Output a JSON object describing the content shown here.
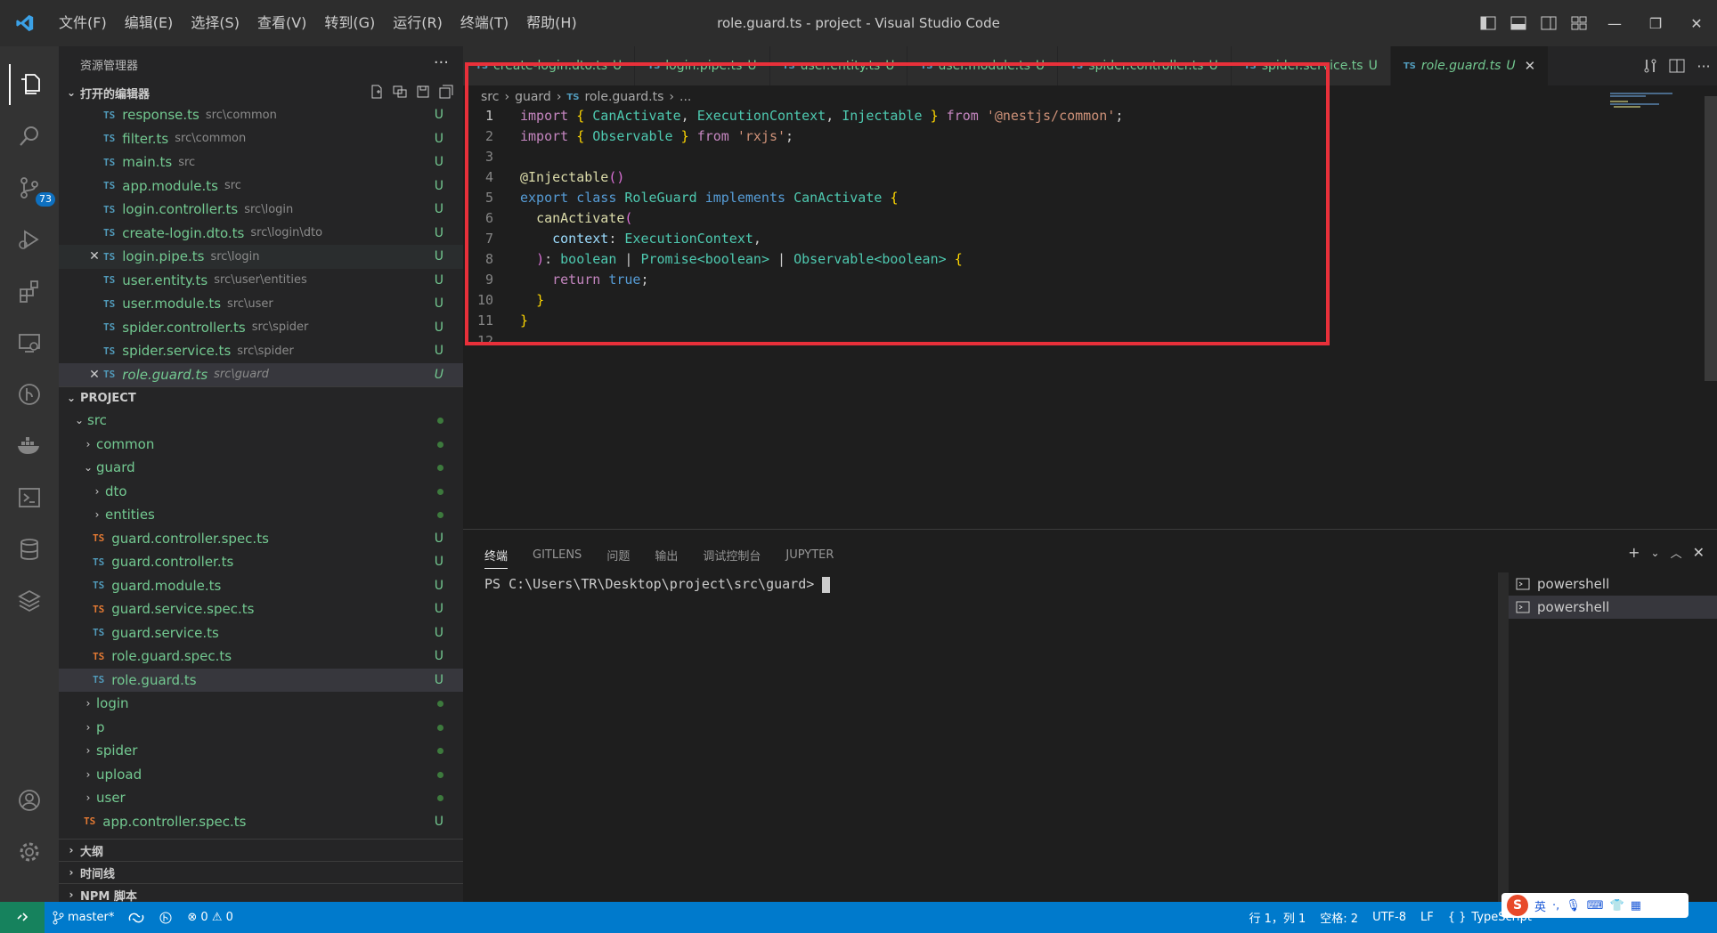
{
  "title_bar": {
    "menus": [
      "文件(F)",
      "编辑(E)",
      "选择(S)",
      "查看(V)",
      "转到(G)",
      "运行(R)",
      "终端(T)",
      "帮助(H)"
    ],
    "window_title": "role.guard.ts - project - Visual Studio Code"
  },
  "activity_bar": {
    "scm_badge": "73"
  },
  "sidebar": {
    "title": "资源管理器",
    "open_editors": {
      "label": "打开的编辑器",
      "items": [
        {
          "name": "response.ts",
          "path": "src\\common",
          "status": "U"
        },
        {
          "name": "filter.ts",
          "path": "src\\common",
          "status": "U"
        },
        {
          "name": "main.ts",
          "path": "src",
          "status": "U"
        },
        {
          "name": "app.module.ts",
          "path": "src",
          "status": "U"
        },
        {
          "name": "login.controller.ts",
          "path": "src\\login",
          "status": "U"
        },
        {
          "name": "create-login.dto.ts",
          "path": "src\\login\\dto",
          "status": "U"
        },
        {
          "name": "login.pipe.ts",
          "path": "src\\login",
          "status": "U"
        },
        {
          "name": "user.entity.ts",
          "path": "src\\user\\entities",
          "status": "U"
        },
        {
          "name": "user.module.ts",
          "path": "src\\user",
          "status": "U"
        },
        {
          "name": "spider.controller.ts",
          "path": "src\\spider",
          "status": "U"
        },
        {
          "name": "spider.service.ts",
          "path": "src\\spider",
          "status": "U"
        },
        {
          "name": "role.guard.ts",
          "path": "src\\guard",
          "status": "U"
        }
      ]
    },
    "project": {
      "label": "PROJECT",
      "src": "src",
      "items": [
        {
          "name": "common"
        },
        {
          "name": "guard"
        },
        {
          "name": "dto"
        },
        {
          "name": "entities"
        },
        {
          "name": "guard.controller.spec.ts",
          "status": "U"
        },
        {
          "name": "guard.controller.ts",
          "status": "U"
        },
        {
          "name": "guard.module.ts",
          "status": "U"
        },
        {
          "name": "guard.service.spec.ts",
          "status": "U"
        },
        {
          "name": "guard.service.ts",
          "status": "U"
        },
        {
          "name": "role.guard.spec.ts",
          "status": "U"
        },
        {
          "name": "role.guard.ts",
          "status": "U"
        },
        {
          "name": "login"
        },
        {
          "name": "p"
        },
        {
          "name": "spider"
        },
        {
          "name": "upload"
        },
        {
          "name": "user"
        },
        {
          "name": "app.controller.spec.ts",
          "status": "U"
        }
      ]
    },
    "outline": "大纲",
    "timeline": "时间线",
    "npm": "NPM 脚本"
  },
  "tabs": [
    {
      "label": "create-login.dto.ts",
      "status": "U"
    },
    {
      "label": "login.pipe.ts",
      "status": "U"
    },
    {
      "label": "user.entity.ts",
      "status": "U"
    },
    {
      "label": "user.module.ts",
      "status": "U"
    },
    {
      "label": "spider.controller.ts",
      "status": "U"
    },
    {
      "label": "spider.service.ts",
      "status": "U"
    },
    {
      "label": "role.guard.ts",
      "status": "U"
    }
  ],
  "breadcrumb": [
    "src",
    "guard",
    "role.guard.ts",
    "..."
  ],
  "code_lines": [
    "import { CanActivate, ExecutionContext, Injectable } from '@nestjs/common';",
    "import { Observable } from 'rxjs';",
    "",
    "@Injectable()",
    "export class RoleGuard implements CanActivate {",
    "  canActivate(",
    "    context: ExecutionContext,",
    "  ): boolean | Promise<boolean> | Observable<boolean> {",
    "    return true;",
    "  }",
    "}",
    ""
  ],
  "panel": {
    "tabs": [
      "终端",
      "GITLENS",
      "问题",
      "输出",
      "调试控制台",
      "JUPYTER"
    ],
    "prompt": "PS C:\\Users\\TR\\Desktop\\project\\src\\guard> ",
    "terminals": [
      "powershell",
      "powershell"
    ]
  },
  "status_bar": {
    "branch": "master*",
    "errors": "0",
    "warnings": "0",
    "position": "行 1，列 1",
    "spaces": "空格: 2",
    "encoding": "UTF-8",
    "eol": "LF",
    "language": "TypeScript"
  },
  "ime": {
    "lang": "英"
  },
  "colors": {
    "accent": "#007acc",
    "highlight_box": "#e8303a",
    "untracked": "#73c991"
  }
}
